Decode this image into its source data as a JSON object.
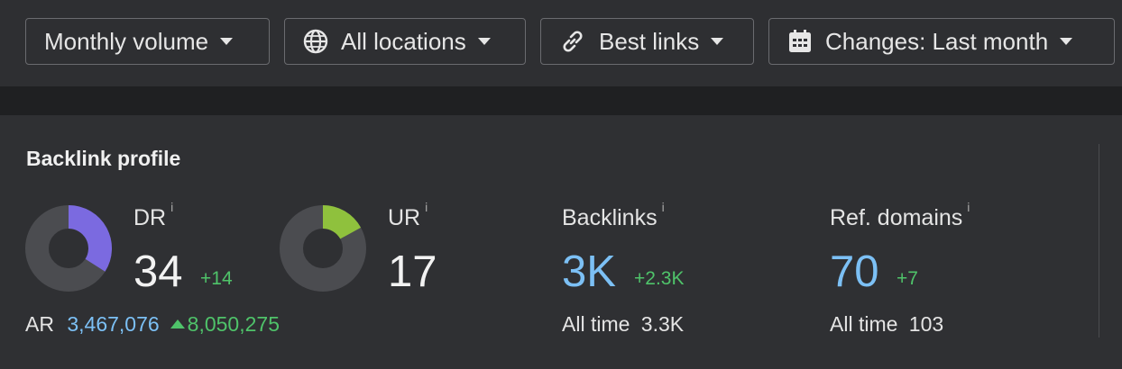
{
  "toolbar": {
    "filters": [
      {
        "label": "Monthly volume",
        "icon": "none"
      },
      {
        "label": "All locations",
        "icon": "globe-icon"
      },
      {
        "label": "Best links",
        "icon": "link-icon"
      },
      {
        "label": "Changes: Last month",
        "icon": "calendar-icon"
      }
    ]
  },
  "backlink_profile": {
    "title": "Backlink profile",
    "dr": {
      "label": "DR",
      "info": "i",
      "value": "34",
      "delta": "+14",
      "ratio": 0.34,
      "color": "#7b6ae0"
    },
    "ur": {
      "label": "UR",
      "info": "i",
      "value": "17",
      "ratio": 0.17,
      "color": "#8fc13d"
    },
    "ar": {
      "label": "AR",
      "value": "3,467,076",
      "change": "8,050,275"
    },
    "backlinks": {
      "label": "Backlinks",
      "info": "i",
      "value": "3K",
      "delta": "+2.3K",
      "all_time_label": "All time",
      "all_time_value": "3.3K"
    },
    "ref_domains": {
      "label": "Ref. domains",
      "info": "i",
      "value": "70",
      "delta": "+7",
      "all_time_label": "All time",
      "all_time_value": "103"
    }
  },
  "colors": {
    "donut_track": "#4b4c50",
    "accent_blue": "#7cc0f5",
    "accent_green": "#4fc36a"
  }
}
